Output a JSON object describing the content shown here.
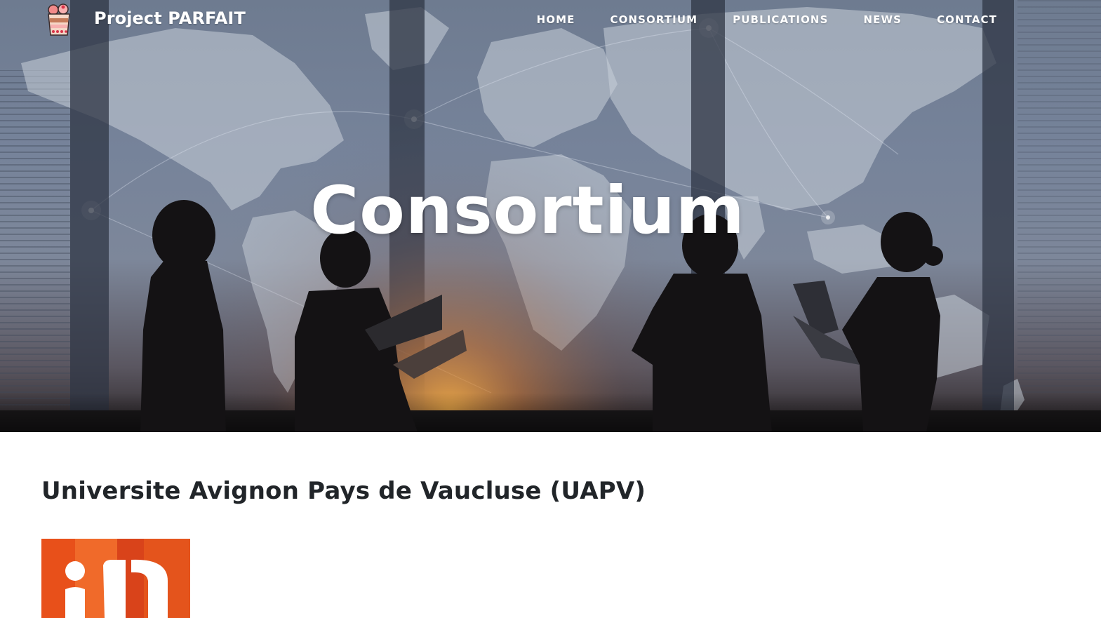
{
  "colors": {
    "nav_text": "#ffffff",
    "heading_text": "#212529",
    "logo_orange": "#e8501a",
    "logo_orange_dark": "#d9431a"
  },
  "navbar": {
    "brand_icon": "parfait-cup-icon",
    "brand_title": "Project PARFAIT",
    "links": [
      {
        "label": "HOME"
      },
      {
        "label": "CONSORTIUM"
      },
      {
        "label": "PUBLICATIONS"
      },
      {
        "label": "NEWS"
      },
      {
        "label": "CONTACT"
      }
    ]
  },
  "hero": {
    "background_image": "business-silhouettes-world-map-photo",
    "title": "Consortium"
  },
  "main": {
    "member": {
      "name": "Universite Avignon Pays de Vaucluse (UAPV)",
      "logo": "uapv-orange-logo"
    }
  }
}
